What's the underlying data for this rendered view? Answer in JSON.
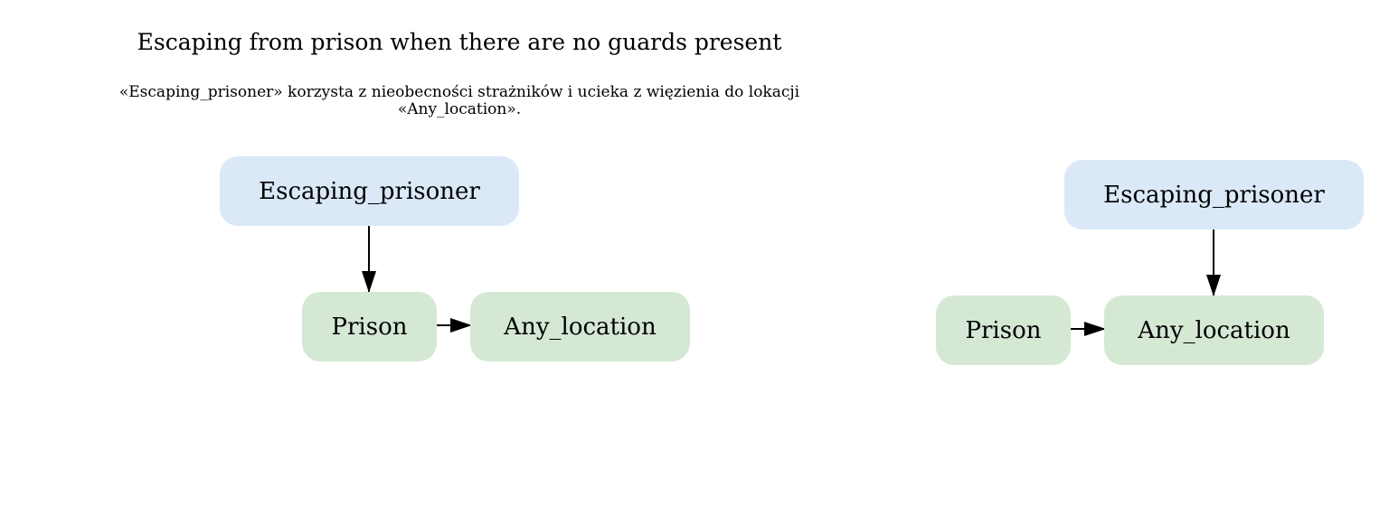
{
  "title": "Escaping from prison when there are no guards present",
  "subtitle": {
    "line1": "«Escaping_prisoner» korzysta z nieobecności strażników i ucieka z więzienia do lokacji",
    "line2": "«Any_location»."
  },
  "colors": {
    "agent_fill": "#dae8f8",
    "place_fill": "#d5e8d4",
    "edge": "#000000"
  },
  "diagrams": [
    {
      "nodes": {
        "agent": "Escaping_prisoner",
        "source": "Prison",
        "target": "Any_location"
      },
      "edges": [
        {
          "from": "Escaping_prisoner",
          "to": "Prison"
        },
        {
          "from": "Prison",
          "to": "Any_location"
        }
      ]
    },
    {
      "nodes": {
        "agent": "Escaping_prisoner",
        "source": "Prison",
        "target": "Any_location"
      },
      "edges": [
        {
          "from": "Escaping_prisoner",
          "to": "Any_location"
        },
        {
          "from": "Prison",
          "to": "Any_location"
        }
      ]
    }
  ]
}
